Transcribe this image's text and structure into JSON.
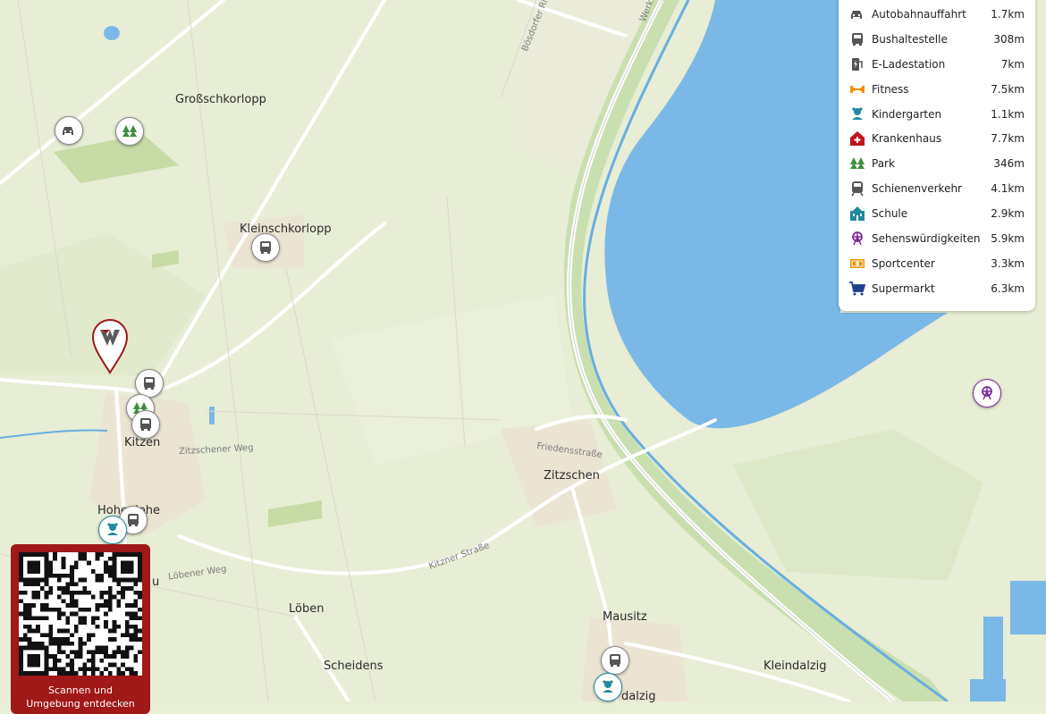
{
  "map": {
    "towns": {
      "grossschkorlopp": "Großschkorlopp",
      "kleinschkorlopp": "Kleinschkorlopp",
      "kitzen": "Kitzen",
      "hohenlohe": "Hohenlohe",
      "zitzschen": "Zitzschen",
      "loeben": "Löben",
      "scheidens": "Scheidens",
      "mausitz": "Mausitz",
      "kleindalzig": "Kleindalzig",
      "dalzig": "dalzig",
      "partial_au": "u"
    },
    "streets": {
      "boesdorfer_ring": "Bösdorfer Ring",
      "werk": "Werk",
      "zitzschener_weg": "Zitzschener Weg",
      "friedensstrasse": "Friedensstraße",
      "kitzner_strasse": "Kitzner Straße",
      "loebener_weg": "Löbener Weg"
    }
  },
  "poi_panel": {
    "items": [
      {
        "icon": "car-icon",
        "name": "Autobahnauffahrt",
        "distance": "1.7km",
        "color": "#555555"
      },
      {
        "icon": "bus-icon",
        "name": "Bushaltestelle",
        "distance": "308m",
        "color": "#555555"
      },
      {
        "icon": "ev-charging-icon",
        "name": "E-Ladestation",
        "distance": "7km",
        "color": "#555555"
      },
      {
        "icon": "dumbbell-icon",
        "name": "Fitness",
        "distance": "7.5km",
        "color": "#f39200"
      },
      {
        "icon": "kindergarten-icon",
        "name": "Kindergarten",
        "distance": "1.1km",
        "color": "#1f8aa0"
      },
      {
        "icon": "hospital-icon",
        "name": "Krankenhaus",
        "distance": "7.7km",
        "color": "#c0141c"
      },
      {
        "icon": "tree-icon",
        "name": "Park",
        "distance": "346m",
        "color": "#3e8e3e"
      },
      {
        "icon": "train-icon",
        "name": "Schienenverkehr",
        "distance": "4.1km",
        "color": "#555555"
      },
      {
        "icon": "school-icon",
        "name": "Schule",
        "distance": "2.9km",
        "color": "#1f8aa0"
      },
      {
        "icon": "ferris-wheel-icon",
        "name": "Sehenswürdigkeiten",
        "distance": "5.9km",
        "color": "#7b2c9c"
      },
      {
        "icon": "stadium-icon",
        "name": "Sportcenter",
        "distance": "3.3km",
        "color": "#f39200"
      },
      {
        "icon": "cart-icon",
        "name": "Supermarkt",
        "distance": "6.3km",
        "color": "#1f3f8f"
      }
    ]
  },
  "qr": {
    "line1": "Scannen und",
    "line2": "Umgebung entdecken"
  },
  "colors": {
    "lake": "#7ab8e8",
    "land": "#e8efd6",
    "brand_red": "#a01818"
  }
}
